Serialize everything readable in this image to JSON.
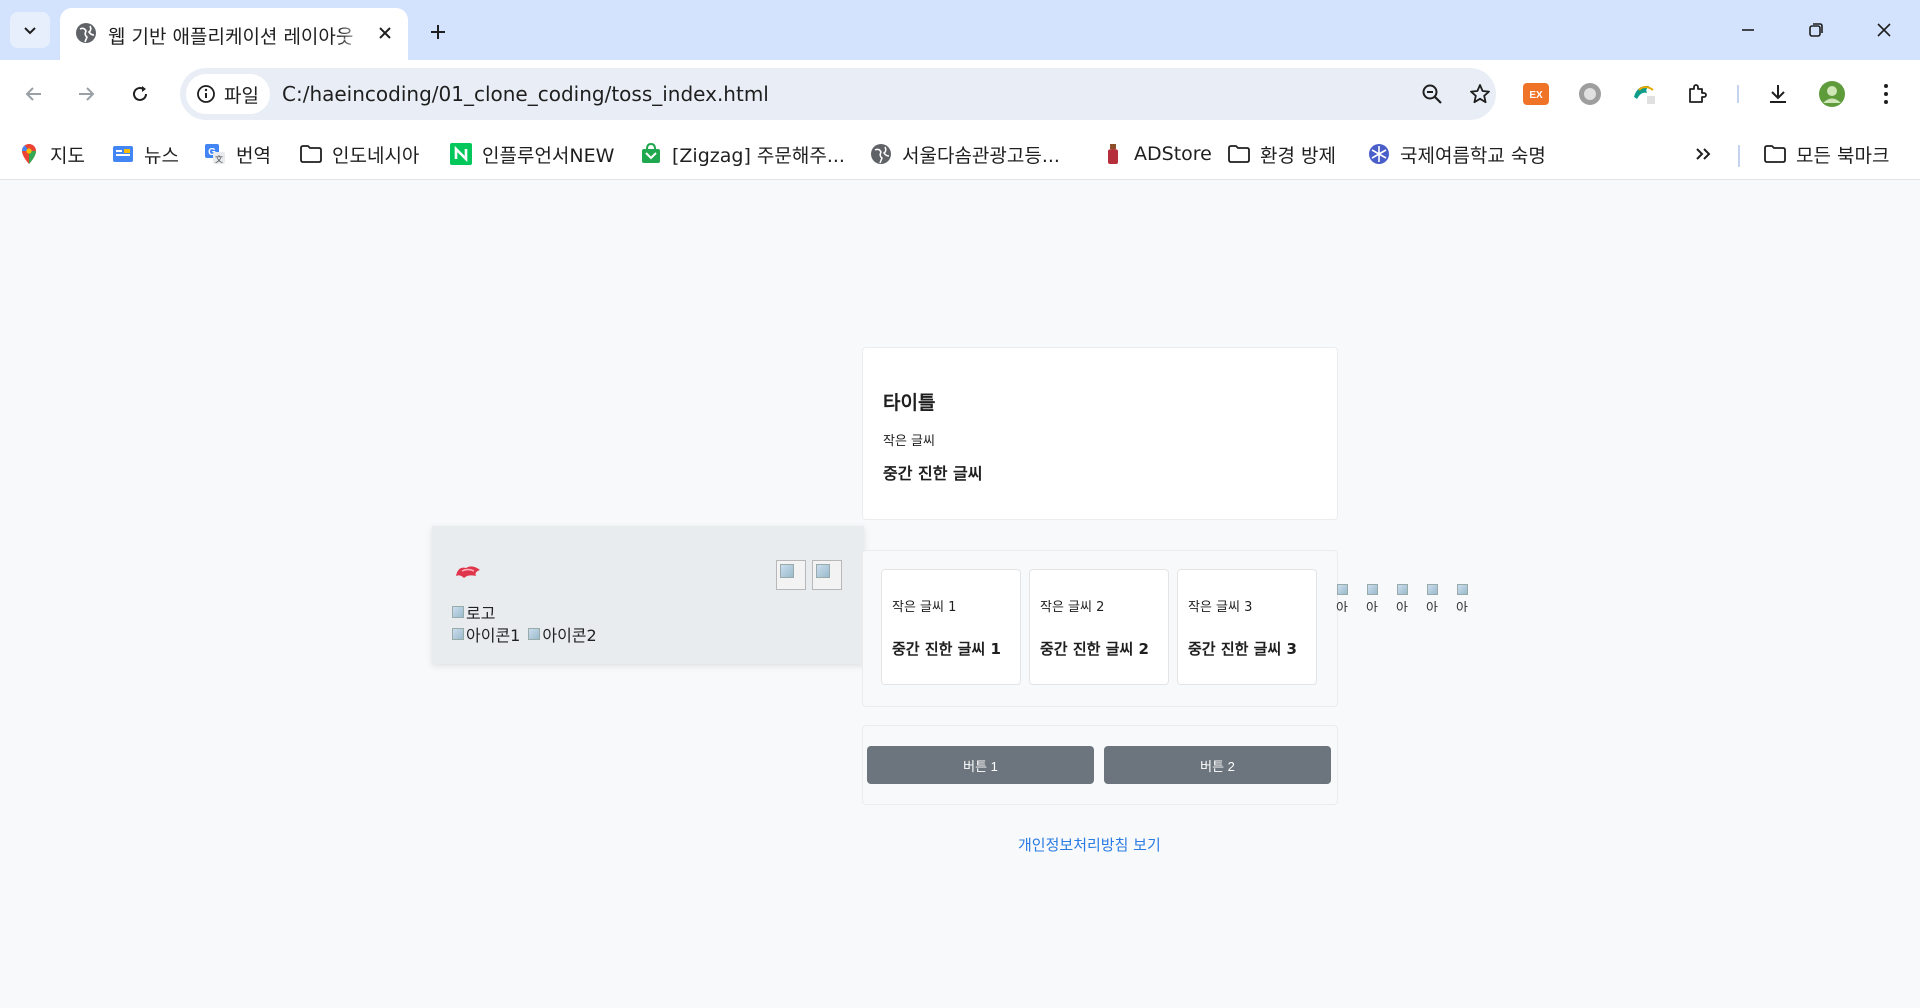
{
  "browser": {
    "tab": {
      "title": "웹 기반 애플리케이션 레이아웃"
    },
    "address": {
      "site_label": "파일",
      "url": "C:/haeincoding/01_clone_coding/toss_index.html"
    },
    "bookmarks": [
      {
        "label": "지도",
        "icon": "maps-pin-icon"
      },
      {
        "label": "뉴스",
        "icon": "news-icon"
      },
      {
        "label": "번역",
        "icon": "translate-icon"
      },
      {
        "label": "인도네시아",
        "icon": "folder-icon"
      },
      {
        "label": "인플루언서NEW",
        "icon": "naver-n-icon"
      },
      {
        "label": "[Zigzag] 주문해주...",
        "icon": "zigzag-icon"
      },
      {
        "label": "서울다솜관광고등...",
        "icon": "globe-icon"
      },
      {
        "label": "ADStore",
        "icon": "bottle-icon"
      },
      {
        "label": "환경 방제",
        "icon": "folder-icon"
      },
      {
        "label": "국제여름학교 숙명",
        "icon": "snowflake-icon"
      }
    ],
    "all_bookmarks": "모든 북마크",
    "colors": {
      "tabstrip": "#d3e3fd",
      "omnibox": "#e9eef6",
      "accent": "#0b57d0"
    }
  },
  "page": {
    "top_card": {
      "title": "타이틀",
      "small_text": "작은 글씨",
      "bold_text": "중간 진한 글씨"
    },
    "left_panel": {
      "logo_alt": "로고",
      "icon1_alt": "아이콘1",
      "icon2_alt": "아이콘2"
    },
    "sub_cards": [
      {
        "small": "작은 글씨 1",
        "bold": "중간 진한 글씨 1"
      },
      {
        "small": "작은 글씨 2",
        "bold": "중간 진한 글씨 2"
      },
      {
        "small": "작은 글씨 3",
        "bold": "중간 진한 글씨 3"
      }
    ],
    "icon_row_alt": [
      "아",
      "아",
      "아",
      "아",
      "아"
    ],
    "buttons": {
      "button1": "버튼 1",
      "button2": "버튼 2"
    },
    "privacy_link": "개인정보처리방침 보기",
    "colors": {
      "button_bg": "#6c757d",
      "link": "#2a7be4",
      "panel_bg": "#e9ecef"
    }
  }
}
